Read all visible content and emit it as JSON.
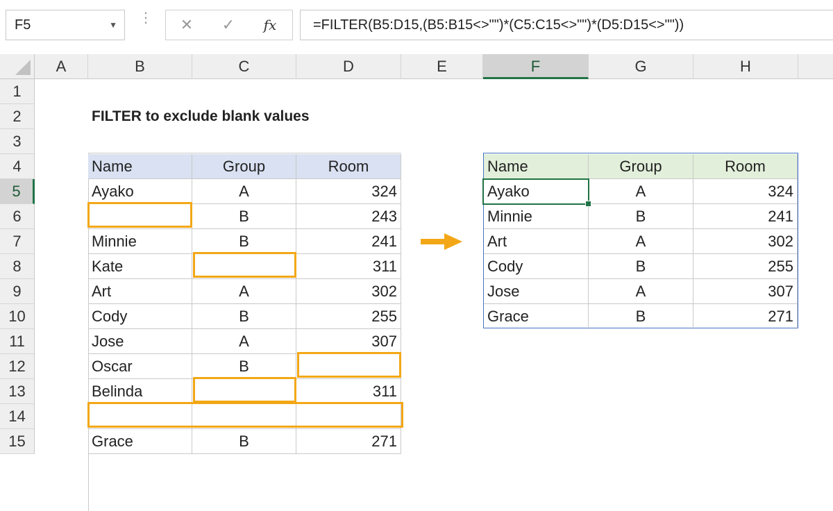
{
  "formula_bar": {
    "name_box": "F5",
    "name_box_arrow": "▼",
    "menu_dots": "⋮",
    "cancel_icon": "✕",
    "enter_icon": "✓",
    "fx_label": "fx",
    "formula": "=FILTER(B5:D15,(B5:B15<>\"\")*(C5:C15<>\"\")*(D5:D15<>\"\"))"
  },
  "columns": [
    "A",
    "B",
    "C",
    "D",
    "E",
    "F",
    "G",
    "H"
  ],
  "rows": [
    "1",
    "2",
    "3",
    "4",
    "5",
    "6",
    "7",
    "8",
    "9",
    "10",
    "11",
    "12",
    "13",
    "14",
    "15"
  ],
  "title": "FILTER to exclude blank values",
  "source_table": {
    "headers": [
      "Name",
      "Group",
      "Room"
    ],
    "rows": [
      [
        "Ayako",
        "A",
        "324"
      ],
      [
        "",
        "B",
        "243"
      ],
      [
        "Minnie",
        "B",
        "241"
      ],
      [
        "Kate",
        "",
        "311"
      ],
      [
        "Art",
        "A",
        "302"
      ],
      [
        "Cody",
        "B",
        "255"
      ],
      [
        "Jose",
        "A",
        "307"
      ],
      [
        "Oscar",
        "B",
        ""
      ],
      [
        "Belinda",
        "",
        "311"
      ],
      [
        "",
        "",
        ""
      ],
      [
        "Grace",
        "B",
        "271"
      ]
    ]
  },
  "result_table": {
    "headers": [
      "Name",
      "Group",
      "Room"
    ],
    "rows": [
      [
        "Ayako",
        "A",
        "324"
      ],
      [
        "Minnie",
        "B",
        "241"
      ],
      [
        "Art",
        "A",
        "302"
      ],
      [
        "Cody",
        "B",
        "255"
      ],
      [
        "Jose",
        "A",
        "307"
      ],
      [
        "Grace",
        "B",
        "271"
      ]
    ]
  },
  "colors": {
    "highlight": "#f3a716",
    "selection": "#217346",
    "header_blue": "#d9e1f2",
    "header_green": "#e2efda",
    "spill_border": "#4472c4"
  },
  "icons": [
    "dropdown-arrow-icon",
    "cancel-icon",
    "enter-icon",
    "function-icon",
    "right-arrow-icon",
    "select-all-icon"
  ]
}
